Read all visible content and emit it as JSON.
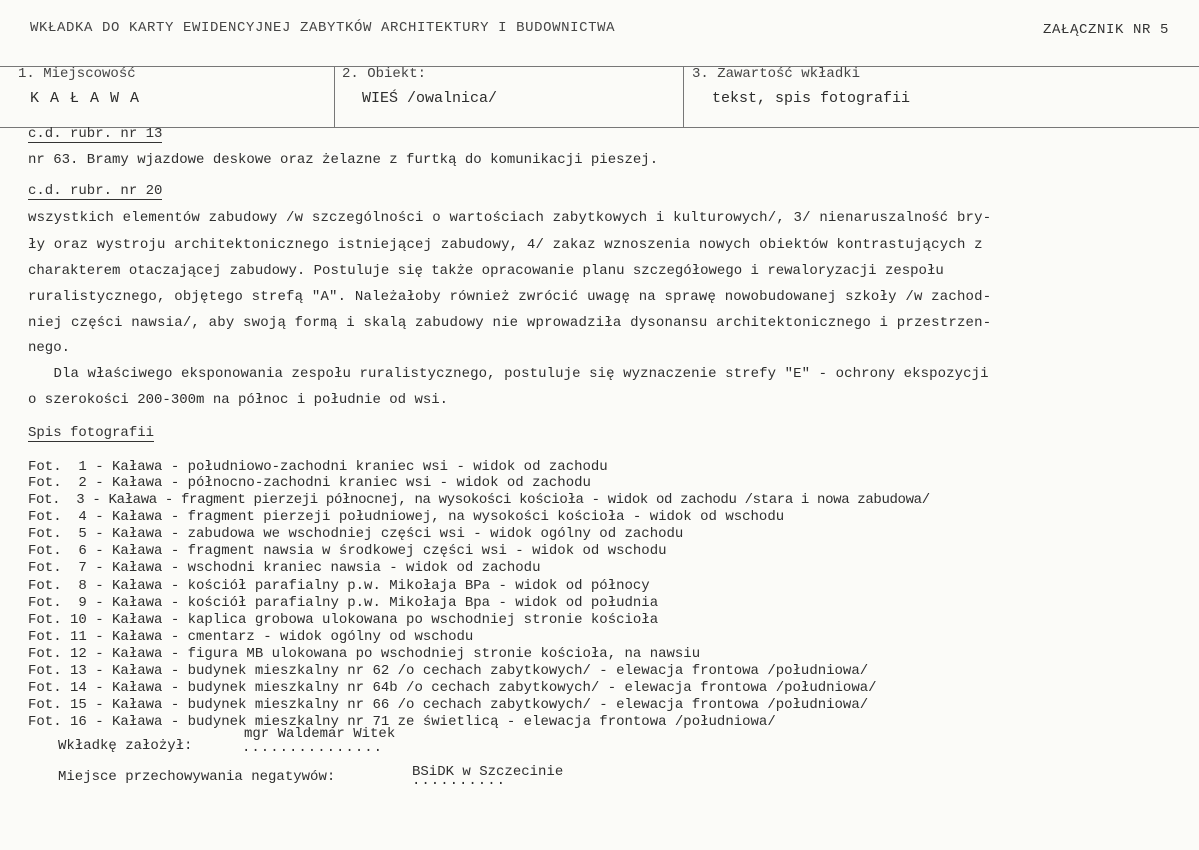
{
  "header": {
    "title": "WKŁADKA DO KARTY EWIDENCYJNEJ ZABYTKÓW ARCHITEKTURY I BUDOWNICTWA",
    "annex": "ZAŁĄCZNIK NR 5"
  },
  "fields": {
    "locality_label": "1. Miejscowość",
    "locality_value": "K A Ł A W A",
    "object_label": "2. Obiekt:",
    "object_value": "WIEŚ /owalnica/",
    "contents_label": "3. Zawartość wkładki",
    "contents_value": "tekst, spis fotografii"
  },
  "rubric13": {
    "heading": "c.d. rubr. nr 13",
    "text": "nr 63. Bramy wjazdowe deskowe oraz żelazne z furtką do komunikacji pieszej."
  },
  "rubric20": {
    "heading": "c.d. rubr. nr 20",
    "lines": [
      "wszystkich elementów zabudowy /w szczególności o wartościach zabytkowych i kulturowych/, 3/ nienaruszalność bry-",
      "ły oraz wystroju architektonicznego istniejącej zabudowy, 4/ zakaz wznoszenia nowych obiektów kontrastujących z",
      "charakterem otaczającej zabudowy. Postuluje się także opracowanie planu szczegółowego i rewaloryzacji zespołu",
      "ruralistycznego, objętego strefą \"A\". Należałoby również zwrócić uwagę na sprawę nowobudowanej szkoły /w zachod-",
      "niej części nawsia/, aby swoją formą i skalą zabudowy nie wprowadziła dysonansu architektonicznego i przestrzen-",
      "nego.",
      "   Dla właściwego eksponowania zespołu ruralistycznego, postuluje się wyznaczenie strefy \"E\" - ochrony ekspozycji",
      "o szerokości 200-300m na północ i południe od wsi."
    ]
  },
  "photos": {
    "heading": "Spis fotografii",
    "items": [
      "Fot.  1 - Kaława - południowo-zachodni kraniec wsi - widok od zachodu",
      "Fot.  2 - Kaława - północno-zachodni kraniec wsi - widok od zachodu",
      "Fot.  3 - Kaława - fragment pierzeji północnej, na wysokości kościoła - widok od zachodu /stara i nowa zabudowa/",
      "Fot.  4 - Kaława - fragment pierzeji południowej, na wysokości kościoła - widok od wschodu",
      "Fot.  5 - Kaława - zabudowa we wschodniej części wsi - widok ogólny od zachodu",
      "Fot.  6 - Kaława - fragment nawsia w środkowej części wsi - widok od wschodu",
      "Fot.  7 - Kaława - wschodni kraniec nawsia - widok od zachodu",
      "Fot.  8 - Kaława - kościół parafialny p.w. Mikołaja BPa - widok od północy",
      "Fot.  9 - Kaława - kościół parafialny p.w. Mikołaja Bpa - widok od południa",
      "Fot. 10 - Kaława - kaplica grobowa ulokowana po wschodniej stronie kościoła",
      "Fot. 11 - Kaława - cmentarz - widok ogólny od wschodu",
      "Fot. 12 - Kaława - figura MB ulokowana po wschodniej stronie kościoła, na nawsiu",
      "Fot. 13 - Kaława - budynek mieszkalny nr 62 /o cechach zabytkowych/ - elewacja frontowa /południowa/",
      "Fot. 14 - Kaława - budynek mieszkalny nr 64b /o cechach zabytkowych/ - elewacja frontowa /południowa/",
      "Fot. 15 - Kaława - budynek mieszkalny nr 66 /o cechach zabytkowych/ - elewacja frontowa /południowa/",
      "Fot. 16 - Kaława - budynek mieszkalny nr 71 ze świetlicą - elewacja frontowa /południowa/"
    ]
  },
  "footer": {
    "author_label": "Wkładkę założył:",
    "author_dots": "...............",
    "author_value": "mgr Waldemar Witek",
    "storage_label": "Miejsce przechowywania negatywów:",
    "storage_dots": "..........",
    "storage_value": "BSiDK w Szczecinie"
  }
}
